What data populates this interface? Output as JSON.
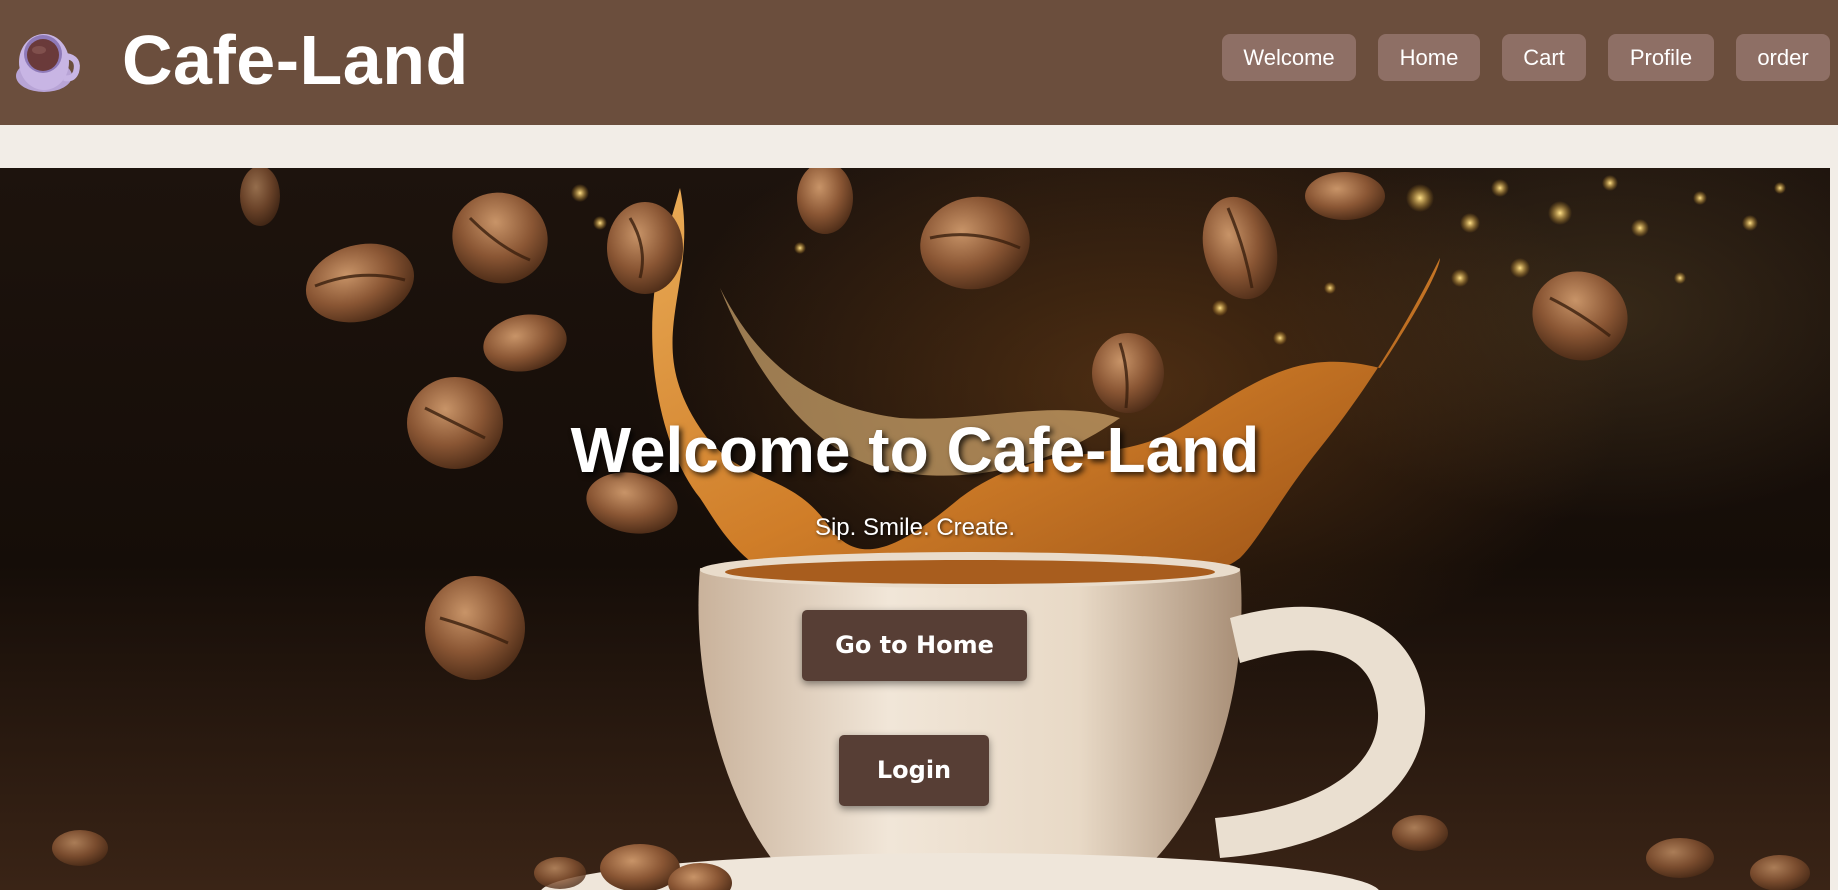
{
  "header": {
    "brand_title": "Cafe-Land",
    "logo_icon": "coffee-cup-icon",
    "nav": {
      "welcome": "Welcome",
      "home": "Home",
      "cart": "Cart",
      "profile": "Profile",
      "order": "order"
    }
  },
  "hero": {
    "title": "Welcome to Cafe-Land",
    "subtitle": "Sip. Smile. Create.",
    "go_home_label": "Go to Home",
    "login_label": "Login",
    "background_image": "coffee-splash-cup-beans"
  },
  "colors": {
    "header_bg": "#6b4e3d",
    "nav_button_bg": "#8e6f65",
    "cta_bg": "#573e35",
    "page_bg": "#f2ede7"
  }
}
